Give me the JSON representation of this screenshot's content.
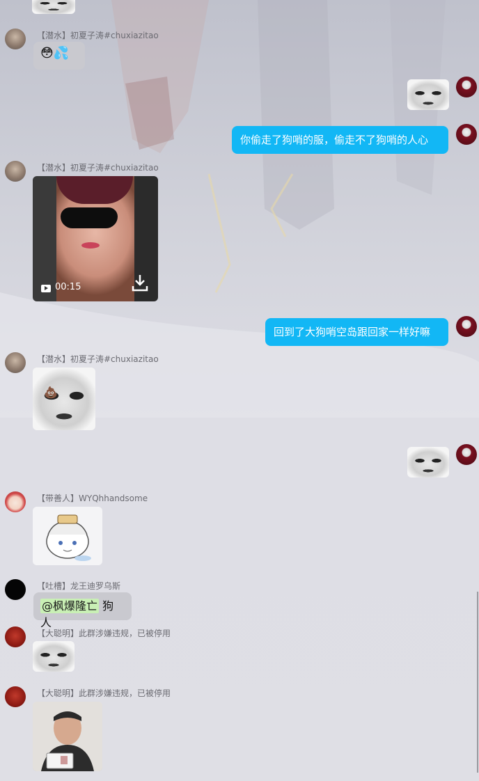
{
  "messages": [
    {
      "id": "m1",
      "direction": "in",
      "sender": "【潜水】初夏子涛#chuxiazitao",
      "content": "😳💦"
    },
    {
      "id": "m2",
      "direction": "out",
      "type": "image",
      "content_icon": "meme-face"
    },
    {
      "id": "m3",
      "direction": "out",
      "type": "text",
      "text": "你偷走了狗哨的服，偷走不了狗哨的人心"
    },
    {
      "id": "m4",
      "direction": "in",
      "sender": "【潜水】初夏子涛#chuxiazitao",
      "type": "video",
      "duration": "00:15"
    },
    {
      "id": "m5",
      "direction": "out",
      "type": "text",
      "text": "回到了大狗哨空岛跟回家一样好嘛"
    },
    {
      "id": "m6",
      "direction": "in",
      "sender": "【潜水】初夏子涛#chuxiazitao",
      "type": "image",
      "content_icon": "meme-poop-emoji",
      "emoji": "💩"
    },
    {
      "id": "m7",
      "direction": "out",
      "type": "image",
      "content_icon": "meme-face"
    },
    {
      "id": "m8",
      "direction": "in",
      "sender": "【带善人】WYQhhandsome",
      "type": "sticker"
    },
    {
      "id": "m9",
      "direction": "in",
      "sender": "【吐槽】龙王迪罗乌斯",
      "type": "text",
      "mention": "@枫爆隆亡",
      "text": " 狗人"
    },
    {
      "id": "m10",
      "direction": "in",
      "sender": "【大聪明】此群涉嫌违规，已被停用",
      "type": "image",
      "content_icon": "meme-face"
    },
    {
      "id": "m11",
      "direction": "in",
      "sender": "【大聪明】此群涉嫌违规，已被停用",
      "type": "image",
      "content_icon": "id-card-photo"
    }
  ],
  "colors": {
    "out_bubble": "#12b7f5",
    "in_bubble": "#c9c9cf",
    "mention_bg": "#c9f0b5"
  }
}
